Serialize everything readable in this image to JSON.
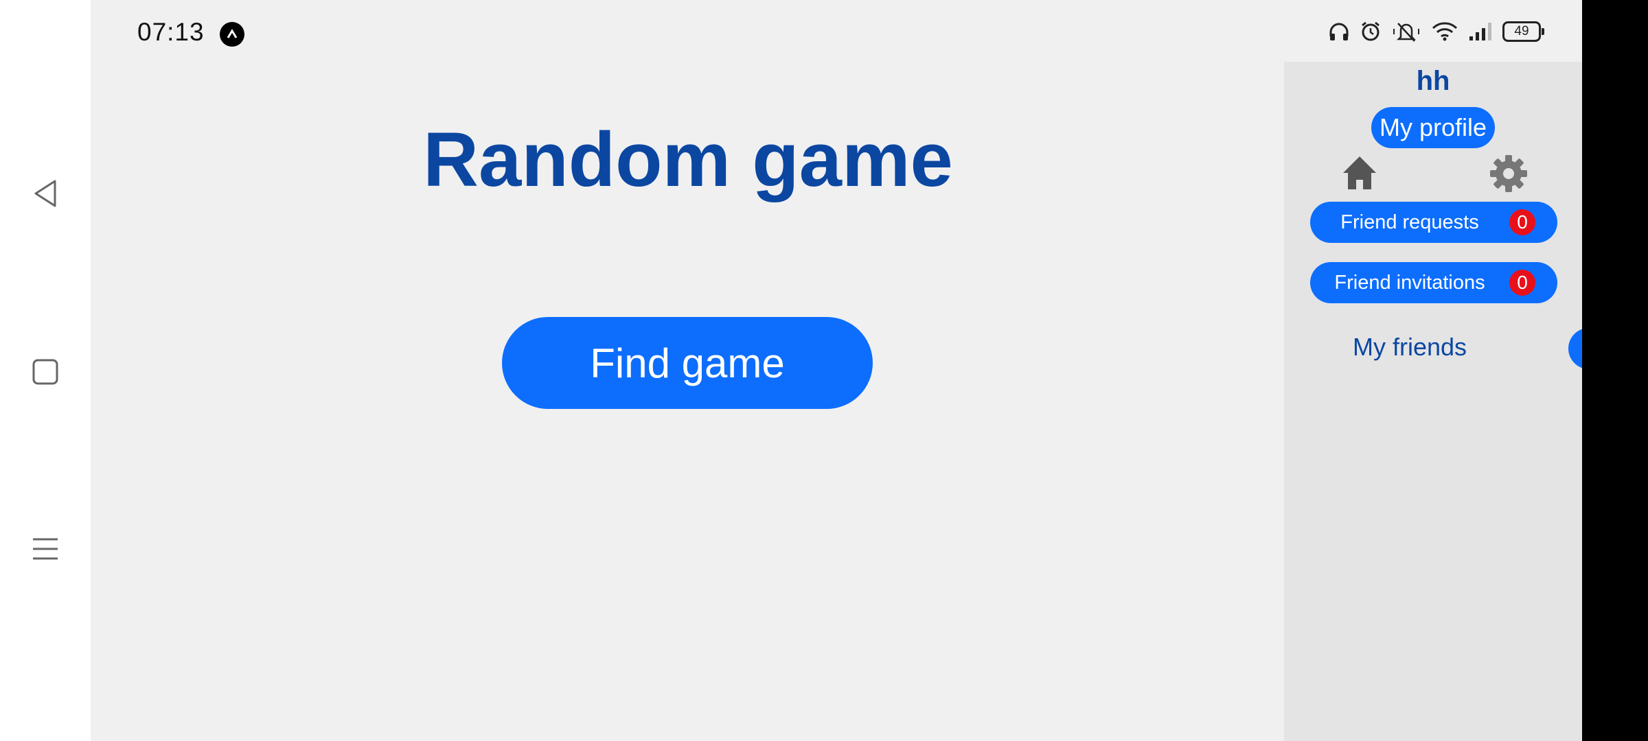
{
  "status_bar": {
    "time": "07:13",
    "battery": "49"
  },
  "main": {
    "title": "Random game",
    "find_game_label": "Find game"
  },
  "sidebar": {
    "username": "hh",
    "profile_label": "My profile",
    "friend_requests": {
      "label": "Friend requests",
      "count": "0"
    },
    "friend_invitations": {
      "label": "Friend invitations",
      "count": "0"
    },
    "my_friends_label": "My friends",
    "add_friend_label": "+"
  },
  "colors": {
    "accent": "#0d6efd",
    "title": "#0b47a1",
    "badge": "#e8101a",
    "app_bg": "#f0f0f1",
    "sidebar_bg": "#e4e4e5"
  },
  "icons": [
    "back-icon",
    "home-square-icon",
    "menu-icon",
    "home-icon",
    "gear-icon",
    "headphones-icon",
    "alarm-icon",
    "mute-icon",
    "wifi-icon",
    "signal-icon",
    "battery-icon"
  ]
}
